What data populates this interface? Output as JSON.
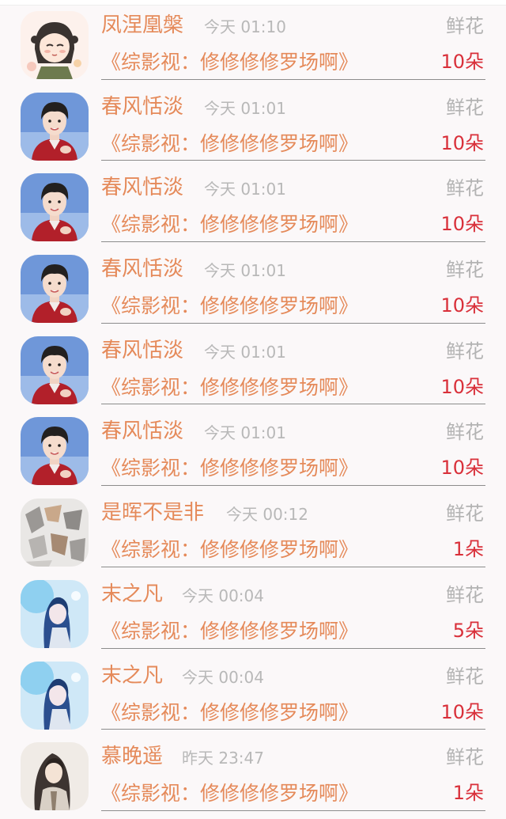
{
  "gift_records": [
    {
      "avatar": "girl-cartoon-avatar",
      "name": "凤涅凰槃",
      "time": "今天 01:10",
      "gift_type": "鲜花",
      "book": "《综影视：修修修修罗场啊》",
      "count": "10朵"
    },
    {
      "avatar": "boy-red-jacket-avatar",
      "name": "春风恬淡",
      "time": "今天 01:01",
      "gift_type": "鲜花",
      "book": "《综影视：修修修修罗场啊》",
      "count": "10朵"
    },
    {
      "avatar": "boy-red-jacket-avatar",
      "name": "春风恬淡",
      "time": "今天 01:01",
      "gift_type": "鲜花",
      "book": "《综影视：修修修修罗场啊》",
      "count": "10朵"
    },
    {
      "avatar": "boy-red-jacket-avatar",
      "name": "春风恬淡",
      "time": "今天 01:01",
      "gift_type": "鲜花",
      "book": "《综影视：修修修修罗场啊》",
      "count": "10朵"
    },
    {
      "avatar": "boy-red-jacket-avatar",
      "name": "春风恬淡",
      "time": "今天 01:01",
      "gift_type": "鲜花",
      "book": "《综影视：修修修修罗场啊》",
      "count": "10朵"
    },
    {
      "avatar": "boy-red-jacket-avatar",
      "name": "春风恬淡",
      "time": "今天 01:01",
      "gift_type": "鲜花",
      "book": "《综影视：修修修修罗场啊》",
      "count": "10朵"
    },
    {
      "avatar": "abstract-grey-avatar",
      "name": "是晖不是非",
      "time": "今天 00:12",
      "gift_type": "鲜花",
      "book": "《综影视：修修修修罗场啊》",
      "count": "1朵"
    },
    {
      "avatar": "blue-anime-avatar",
      "name": "末之凡",
      "time": "今天 00:04",
      "gift_type": "鲜花",
      "book": "《综影视：修修修修罗场啊》",
      "count": "5朵"
    },
    {
      "avatar": "blue-anime-avatar",
      "name": "末之凡",
      "time": "今天 00:04",
      "gift_type": "鲜花",
      "book": "《综影视：修修修修罗场啊》",
      "count": "10朵"
    },
    {
      "avatar": "long-hair-portrait-avatar",
      "name": "慕晚遥",
      "time": "昨天 23:47",
      "gift_type": "鲜花",
      "book": "《综影视：修修修修罗场啊》",
      "count": "1朵"
    }
  ],
  "colors": {
    "name_and_book": "#e58a5a",
    "count": "#d9303a",
    "muted": "#b3b3b3",
    "background": "#fbf8f9"
  }
}
